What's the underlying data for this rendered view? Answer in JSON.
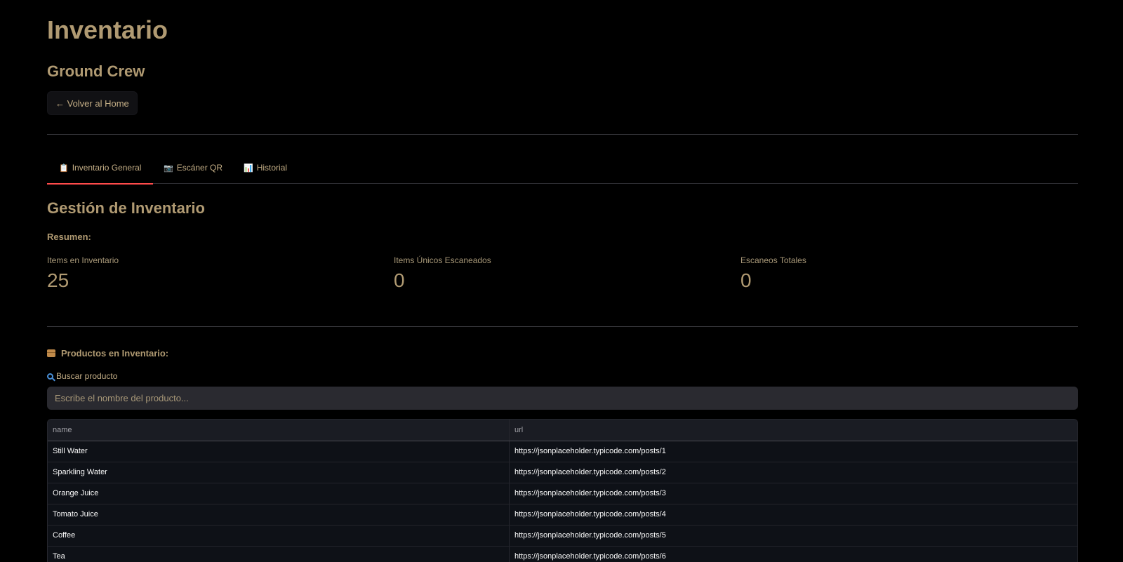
{
  "page": {
    "title": "Inventario",
    "subtitle": "Ground Crew"
  },
  "nav": {
    "back_label": "← Volver al Home"
  },
  "tabs": [
    {
      "icon": "clipboard-icon",
      "glyph": "📋",
      "label": "Inventario General",
      "active": true
    },
    {
      "icon": "camera-icon",
      "glyph": "📷",
      "label": "Escáner QR",
      "active": false
    },
    {
      "icon": "bar-chart-icon",
      "glyph": "📊",
      "label": "Historial",
      "active": false
    }
  ],
  "inventory": {
    "section_title": "Gestión de Inventario",
    "summary_label": "Resumen:",
    "metrics": [
      {
        "label": "Items en Inventario",
        "value": "25"
      },
      {
        "label": "Items Únicos Escaneados",
        "value": "0"
      },
      {
        "label": "Escaneos Totales",
        "value": "0"
      }
    ],
    "products_title": "Productos en Inventario:",
    "products_icon": "package-icon",
    "search": {
      "label": "Buscar producto",
      "icon": "magnifier-icon",
      "placeholder": "Escribe el nombre del producto..."
    },
    "table": {
      "columns": [
        "name",
        "url"
      ],
      "rows": [
        {
          "name": "Still Water",
          "url": "https://jsonplaceholder.typicode.com/posts/1"
        },
        {
          "name": "Sparkling Water",
          "url": "https://jsonplaceholder.typicode.com/posts/2"
        },
        {
          "name": "Orange Juice",
          "url": "https://jsonplaceholder.typicode.com/posts/3"
        },
        {
          "name": "Tomato Juice",
          "url": "https://jsonplaceholder.typicode.com/posts/4"
        },
        {
          "name": "Coffee",
          "url": "https://jsonplaceholder.typicode.com/posts/5"
        },
        {
          "name": "Tea",
          "url": "https://jsonplaceholder.typicode.com/posts/6"
        }
      ]
    }
  },
  "colors": {
    "background": "#000000",
    "accent_text": "#b09a72",
    "active_tab_underline": "#ff4b4b"
  }
}
